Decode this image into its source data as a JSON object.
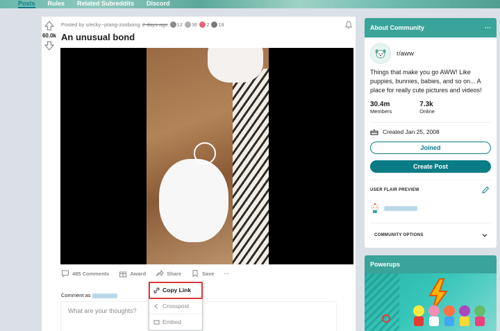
{
  "nav": {
    "tabs": [
      "Posts",
      "Rules",
      "Related Subreddits",
      "Discord"
    ]
  },
  "post": {
    "score": "60.0k",
    "posted_by": "Posted by u/ecky--ptang-zooboing",
    "time_ago": "2 days ago",
    "awards": [
      {
        "icon": "award-icon",
        "count": "12",
        "color": "#8a8a8a"
      },
      {
        "icon": "award-icon",
        "count": "36",
        "color": "#b0b0b0"
      },
      {
        "icon": "heart-award-icon",
        "count": "2",
        "color": "#e0687a"
      },
      {
        "icon": "award-icon",
        "count": "18",
        "color": "#7a7a7a"
      }
    ],
    "title": "An unusual bond",
    "actions": {
      "comments": "485 Comments",
      "award": "Award",
      "share": "Share",
      "save": "Save",
      "more": "···"
    },
    "comment_as": "Comment as",
    "comment_placeholder": "What are your thoughts?"
  },
  "share_menu": {
    "items": [
      "Copy Link",
      "Crosspost",
      "Embed"
    ],
    "highlight_color": "#d93a3a"
  },
  "sidebar": {
    "about_title": "About Community",
    "more": "···",
    "community_name": "r/aww",
    "description": "Things that make you go AWW! Like puppies, bunnies, babies, and so on... A place for really cute pictures and videos!",
    "members_count": "30.4m",
    "members_label": "Members",
    "online_count": "7.3k",
    "online_label": "Online",
    "created": "Created Jan 25, 2008",
    "joined_label": "Joined",
    "create_post_label": "Create Post",
    "flair_preview_label": "USER FLAIR PREVIEW",
    "community_options_label": "COMMUNITY OPTIONS",
    "powerups_title": "Powerups",
    "accent": "#0a7c86",
    "header_color": "#3aa39a"
  }
}
